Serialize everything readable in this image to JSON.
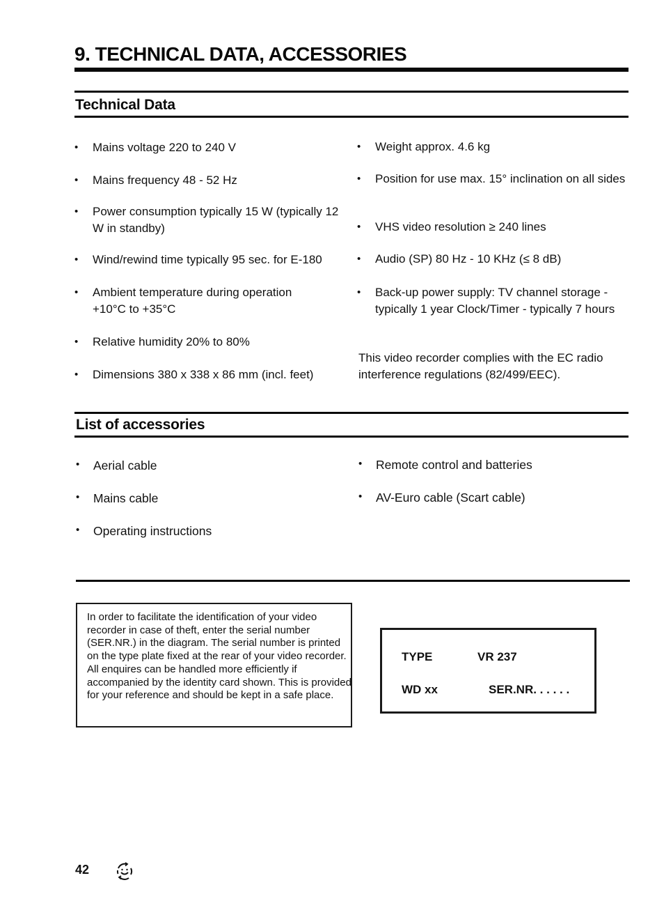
{
  "header": {
    "title": "9. TECHNICAL DATA, ACCESSORIES"
  },
  "technical_data": {
    "title": "Technical Data",
    "left_items": [
      "Mains voltage 220 to 240 V",
      "Mains frequency 48 - 52 Hz",
      "Power consumption typically 15 W (typically 12 W in standby)",
      "Wind/rewind time typically 95 sec. for E-180",
      "Ambient temperature during operation +10°C to +35°C",
      "Relative humidity 20% to 80%",
      "Dimensions 380 x 338 x 86 mm (incl. feet)"
    ],
    "right_items": [
      "Weight approx. 4.6 kg",
      "Position for use max. 15° inclination on all sides",
      "VHS video resolution ≥ 240 lines",
      "Audio (SP) 80 Hz - 10 KHz (≤ 8 dB)",
      "Back-up power supply: TV channel storage - typically 1 year Clock/Timer - typically 7 hours"
    ],
    "compliance_note": "This video recorder complies with the EC radio interference regulations (82/499/EEC)."
  },
  "accessories": {
    "title": "List of accessories",
    "left_items": [
      "Aerial cable",
      "Mains cable",
      "Operating instructions"
    ],
    "right_items": [
      "Remote control and batteries",
      "AV-Euro cable (Scart cable)"
    ]
  },
  "info_box": {
    "text": "In order to facilitate the identification of your video recorder in case of theft, enter the serial number (SER.NR.) in the diagram. The serial number is printed on the type plate fixed at the rear of your video recorder. All enquires can be handled more efficiently if accompanied by the identity card shown. This is provided for your reference and should be kept in a safe place."
  },
  "id_card": {
    "type_label": "TYPE",
    "type_value": "VR 237",
    "wd_label": "WD xx",
    "serial_label": "SER.NR. . . . . ."
  },
  "footer": {
    "page_number": "42",
    "icon": "recycle-smiley-icon"
  },
  "bullet": "•"
}
